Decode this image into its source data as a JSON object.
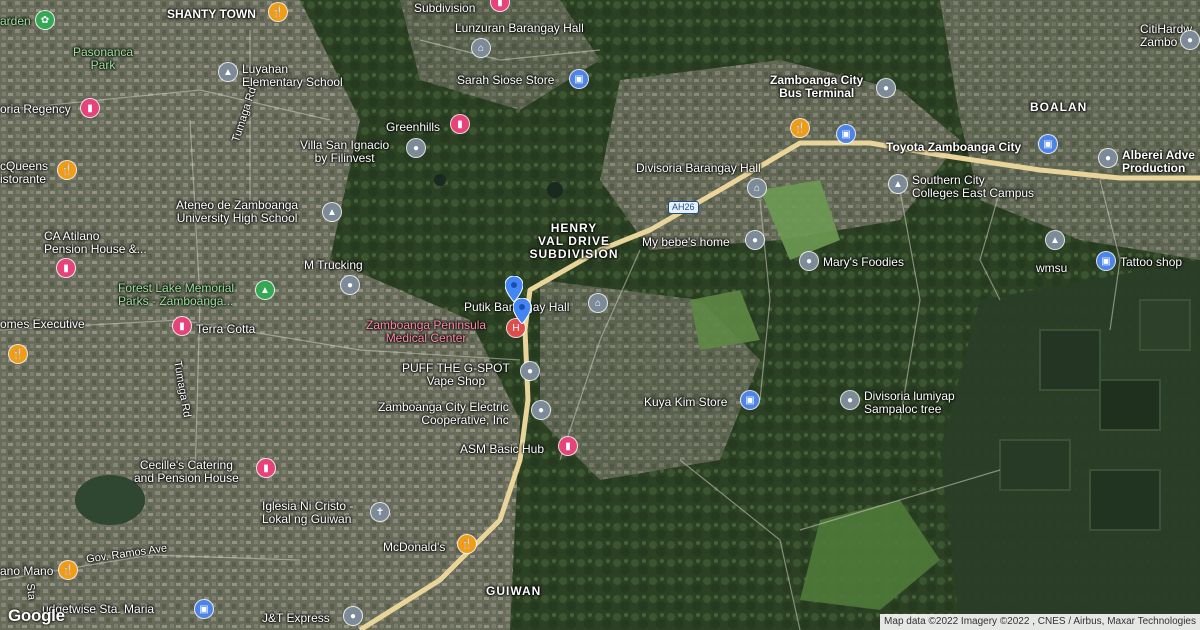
{
  "map": {
    "attribution": "Map data ©2022 Imagery ©2022 , CNES / Airbus, Maxar Technologies",
    "logo": "Google",
    "route_shield": "AH26",
    "colors": {
      "road": "#e9d59a",
      "satellite_dark": "#2f3a26",
      "pin_gray": "#7d8b99",
      "pin_pink": "#e8427a",
      "pin_orange": "#f29c14",
      "pin_blue": "#4c84e8",
      "marker_blue": "#4285f4",
      "hospital_red": "#e04b4b"
    }
  },
  "areas": {
    "henry_val": "HENRY\nVAL DRIVE\nSUBDIVISION",
    "boalan": "BOALAN",
    "guiwan": "GUIWAN",
    "shanty_town": "SHANTY TOWN"
  },
  "places": {
    "garden": "arden",
    "pasonanca_park": "Pasonanca\nPark",
    "luyahan": "Luyahan\nElementary School",
    "subdivision_top": "Subdivision",
    "lunzuran": "Lunzuran Barangay Hall",
    "sarah_siose": "Sarah Siose Store",
    "zc_bus_terminal": "Zamboanga City\nBus Terminal",
    "citihardware": "CitiHardw\nZambo",
    "divisoria_regency": "oria Regency",
    "greenhills": "Greenhills",
    "villa_san_ignacio": "Villa San Ignacio\nby Filinvest",
    "toyota": "Toyota Zamboanga City",
    "alberei": "Alberei Adve\nProduction",
    "mcqueens": "cQueens\nistorante",
    "divisoria_brgy": "Divisoria Barangay Hall",
    "southern_city": "Southern City\nColleges East Campus",
    "ateneo": "Ateneo de Zamboanga\nUniversity High School",
    "ca_atilano": "CA Atilano\nPension House &...",
    "my_bebes_home": "My bebe's home",
    "wmsu": "wmsu",
    "m_trucking": "M Trucking",
    "marys_foodies": "Mary's Foodies",
    "tattoo_shop": "Tattoo shop",
    "forest_lake": "Forest Lake Memorial\nParks - Zamboanga...",
    "putik_brgy": "Putik Barangay Hall",
    "homes_exec": "omes Executive",
    "terra_cotta": "Terra Cotta",
    "zpmc": "Zamboanga Peninsula\nMedical Center",
    "puff": "PUFF THE G-SPOT\nVape Shop",
    "kuya_kim": "Kuya Kim Store",
    "divisoria_lumiyap": "Divisoria lumiyap\nSampaloc tree",
    "zcec": "Zamboanga City Electric\nCooperative, Inc",
    "asm": "ASM Basic Hub",
    "cecilles": "Cecille's Catering\nand Pension House",
    "iglesia": "Iglesia Ni Cristo -\nLokal ng Guiwan",
    "gov_ramos": "Gov. Ramos Ave",
    "mcdonalds": "McDonald's",
    "nano_mano": "ano Mano",
    "budgetwise": "udgetwise Sta. Maria",
    "jt_express": "J&T Express",
    "tumaga_rd_1": "Tumaga Rd",
    "tumaga_rd_2": "Tumaga Rd",
    "sta": "Sta"
  }
}
